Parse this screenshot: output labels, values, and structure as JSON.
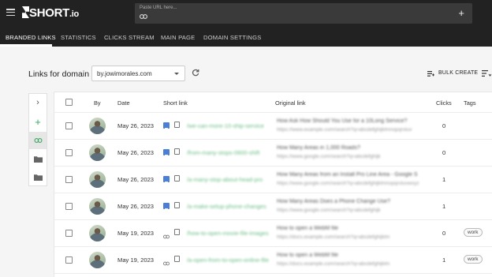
{
  "header": {
    "logo_main": "SHORT",
    "logo_suffix": ".io",
    "url_placeholder": "Paste URL here...",
    "menu_icon": "hamburger-icon",
    "link_icon": "link-icon",
    "add_icon": "plus-icon"
  },
  "nav": {
    "tabs": [
      {
        "label": "BRANDED LINKS",
        "active": true
      },
      {
        "label": "STATISTICS"
      },
      {
        "label": "CLICKS STREAM"
      },
      {
        "label": "MAIN PAGE"
      },
      {
        "label": "DOMAIN SETTINGS"
      }
    ]
  },
  "toolbar": {
    "title": "Links for domain",
    "domain": "by.jowimorales.com",
    "refresh_icon": "refresh-icon",
    "bulk_create": "BULK CREATE",
    "filter_icon": "filter-list-icon"
  },
  "sidebar": {
    "icons": [
      "chevron-right-icon",
      "plus-icon",
      "link-icon",
      "folder-icon",
      "folder-icon"
    ]
  },
  "table": {
    "columns": [
      "By",
      "Date",
      "Short link",
      "Original link",
      "Clicks",
      "Tags"
    ],
    "rows": [
      {
        "date": "May 26, 2023",
        "short": "/we-can-more-10-ship-service",
        "orig_title": "How Ask How Should You Use for a 10Long Service?",
        "orig_url": "https://www.example.com/search?q=abcdefghijklmnopqrstuv",
        "clicks": "0",
        "tag": "",
        "icon_type": "doc"
      },
      {
        "date": "May 26, 2023",
        "short": "/from-many-stops-0600-shift",
        "orig_title": "How Many Areas in 1,000 Roads?",
        "orig_url": "https://www.google.com/search?q=abcdefghijk",
        "clicks": "0",
        "tag": "",
        "icon_type": "doc"
      },
      {
        "date": "May 26, 2023",
        "short": "/a-many-stop-about-head-pro",
        "orig_title": "How Many Areas from an Install Pro Line Area - Google S",
        "orig_url": "https://www.google.com/search?q=abcdefghijklmnopqrstuvwxyz",
        "clicks": "1",
        "tag": "",
        "icon_type": "doc"
      },
      {
        "date": "May 26, 2023",
        "short": "/a-make-setup-phone-changes",
        "orig_title": "How Many Areas Does a Phone Change Use?",
        "orig_url": "https://www.google.com/search?q=abcdefghijk",
        "clicks": "1",
        "tag": "",
        "icon_type": "doc"
      },
      {
        "date": "May 19, 2023",
        "short": "/how-to-open-movie-file-images",
        "orig_title": "How to open a WebM file",
        "orig_url": "https://docs.example.com/search?q=abcdefghijklm",
        "clicks": "0",
        "tag": "work",
        "icon_type": "link"
      },
      {
        "date": "May 19, 2023",
        "short": "/a-open-from-to-open-online-file",
        "orig_title": "How to open a WebM file",
        "orig_url": "https://docs.example.com/search?q=abcdefghijklm",
        "clicks": "1",
        "tag": "work",
        "icon_type": "link"
      }
    ]
  },
  "colors": {
    "header_bg": "#222222",
    "page_bg": "#f5f5f5",
    "short_link": "#6cbf86",
    "doc_icon": "#4a7fd6"
  }
}
